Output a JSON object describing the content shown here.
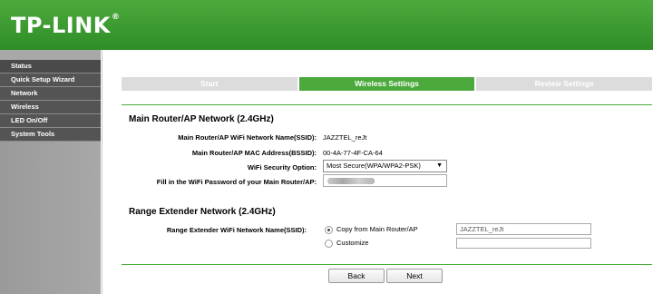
{
  "brand": {
    "logo_text": "TP-LINK",
    "logo_mark": "®"
  },
  "sidebar": {
    "items": [
      {
        "label": "Status"
      },
      {
        "label": "Quick Setup Wizard"
      },
      {
        "label": "Network"
      },
      {
        "label": "Wireless"
      },
      {
        "label": "LED On/Off"
      },
      {
        "label": "System Tools"
      }
    ]
  },
  "steps": [
    {
      "label": "Start",
      "state": "done"
    },
    {
      "label": "Wireless Settings",
      "state": "active"
    },
    {
      "label": "Review Settings",
      "state": "pending"
    }
  ],
  "main_router": {
    "title": "Main Router/AP Network  (2.4GHz)",
    "ssid_label": "Main Router/AP WiFi Network Name(SSID):",
    "ssid_value": "JAZZTEL_reJt",
    "mac_label": "Main Router/AP MAC Address(BSSID):",
    "mac_value": "00-4A-77-4F-CA-64",
    "security_label": "WiFi Security Option:",
    "security_value": "Most Secure(WPA/WPA2-PSK)",
    "password_label": "Fill in the WiFi Password of your Main Router/AP:"
  },
  "range_extender": {
    "title": "Range Extender Network  (2.4GHz)",
    "ssid_label": "Range Extender WiFi Network Name(SSID):",
    "option_copy": "Copy from Main Router/AP",
    "option_customize": "Customize",
    "copied_ssid": "JAZZTEL_reJt",
    "custom_ssid": ""
  },
  "buttons": {
    "back": "Back",
    "next": "Next"
  },
  "colors": {
    "accent": "#4caa3c",
    "sidebar_item": "#545454"
  }
}
